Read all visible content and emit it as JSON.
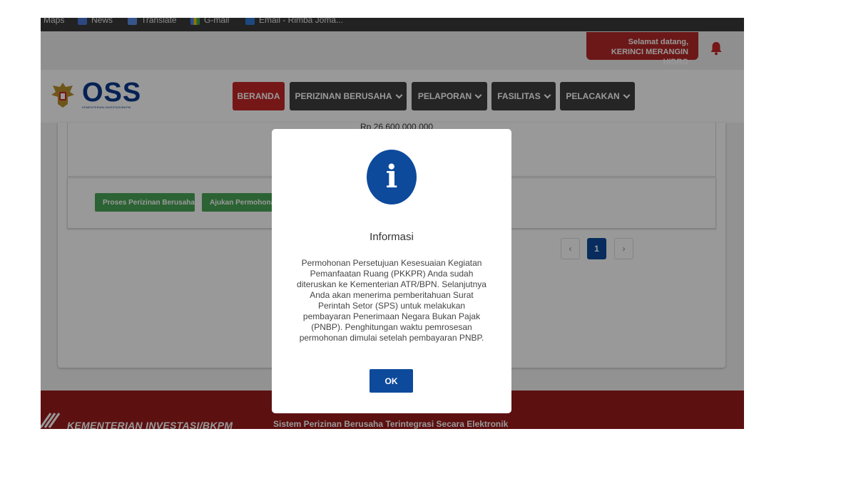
{
  "bookmarks": [
    {
      "label": "Maps",
      "icon": "maps-icon"
    },
    {
      "label": "News",
      "icon": "news-icon"
    },
    {
      "label": "Translate",
      "icon": "translate-icon"
    },
    {
      "label": "G-mail",
      "icon": "gmail-icon"
    },
    {
      "label": "Email - Rimba Joma...",
      "icon": "email-icon"
    }
  ],
  "header": {
    "welcome_line1": "Selamat datang,",
    "welcome_line2": "KERINCI MERANGIN HIDRO",
    "bell_icon": "bell-icon"
  },
  "logo": {
    "text": "OSS",
    "subtitle": "KEMENTERIAN INVESTASI/BKPM"
  },
  "nav": {
    "items": [
      {
        "label": "BERANDA"
      },
      {
        "label": "PERIZINAN BERUSAHA"
      },
      {
        "label": "PELAPORAN"
      },
      {
        "label": "FASILITAS"
      },
      {
        "label": "PELACAKAN"
      }
    ]
  },
  "content": {
    "amount": "Rp 26.600.000.000",
    "actions": [
      {
        "label": "Proses Perizinan Berusaha"
      },
      {
        "label": "Ajukan Permohonan"
      }
    ],
    "pagination": {
      "prev": "‹",
      "current": "1",
      "next": "›"
    }
  },
  "footer": {
    "brand": "KEMENTERIAN INVESTASI/BKPM",
    "tagline": "Sistem Perizinan Berusaha Terintegrasi Secara Elektronik"
  },
  "modal": {
    "icon": "info-icon",
    "icon_glyph": "i",
    "title": "Informasi",
    "message": "Permohonan Persetujuan Kesesuaian Kegiatan Pemanfaatan Ruang (PKKPR) Anda sudah diteruskan ke Kementerian ATR/BPN. Selanjutnya Anda akan menerima pemberitahuan Surat Perintah Setor (SPS) untuk melakukan pembayaran Penerimaan Negara Bukan Pajak (PNBP). Penghitungan waktu pemrosesan permohonan dimulai setelah pembayaran PNBP.",
    "ok_label": "OK"
  },
  "colors": {
    "primary_blue": "#0d4a9c",
    "nav_active_red": "#c32727",
    "footer_red": "#9b1c1c",
    "action_green": "#4aa657"
  }
}
